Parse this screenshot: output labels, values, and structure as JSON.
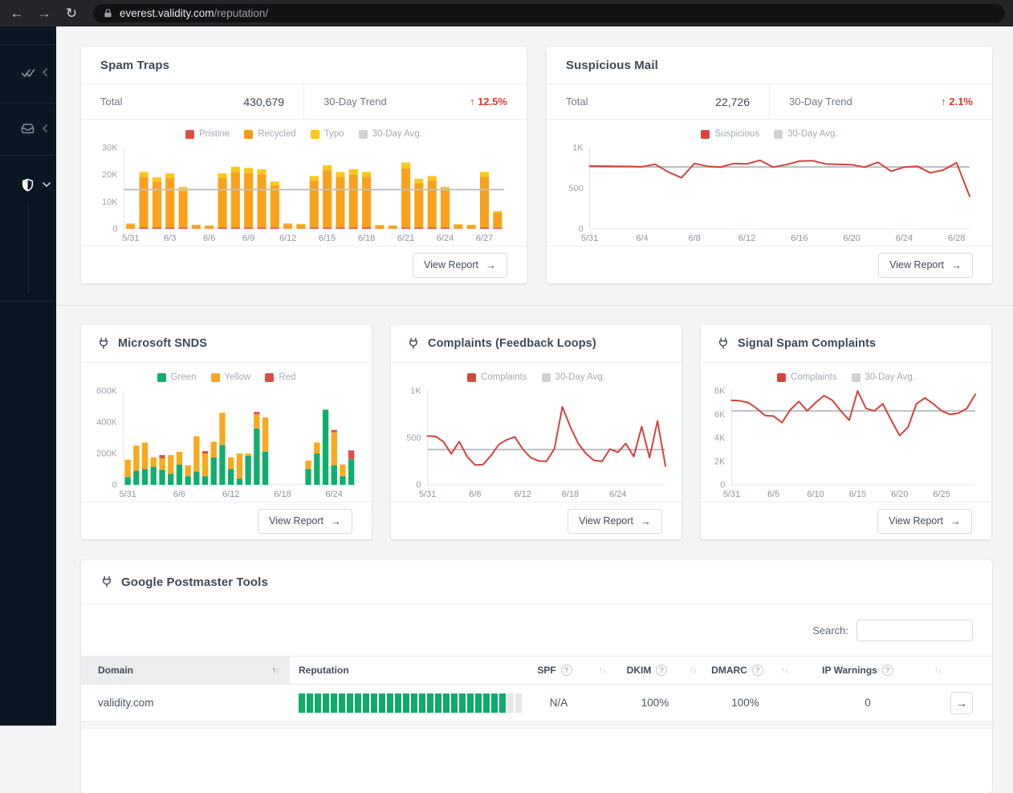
{
  "browser": {
    "back_glyph": "←",
    "forward_glyph": "→",
    "refresh_glyph": "↻",
    "url_host": "everest.validity.com",
    "url_path": "/reputation/"
  },
  "ui": {
    "view_report": "View Report",
    "arrow_right": "→",
    "search_label": "Search:",
    "help_glyph": "?",
    "sort_up": "↑",
    "sort_down": "↓"
  },
  "colors": {
    "trend_red": "#d43a32",
    "chart_red": "#d2423e",
    "avg_gray": "#bdc0c4",
    "orange": "#faa11b",
    "yellow": "#ffc61a",
    "pristine_red": "#d95049",
    "green": "#10ae6d",
    "rep_bar_green": "#10ab6b",
    "sidebar_bg": "#0b1623"
  },
  "sidebar": {
    "items": [
      {
        "name": "validation",
        "icon": "double-check-icon",
        "state": "collapsed"
      },
      {
        "name": "inbox",
        "icon": "inbox-icon",
        "state": "collapsed"
      },
      {
        "name": "reputation",
        "icon": "shield-icon",
        "state": "expanded-active"
      }
    ]
  },
  "cards": {
    "spam_traps": {
      "title": "Spam Traps",
      "total_label": "Total",
      "total_value": "430,679",
      "trend_label": "30-Day Trend",
      "trend_arrow": "↑",
      "trend_value": "12.5%"
    },
    "suspicious_mail": {
      "title": "Suspicious Mail",
      "total_label": "Total",
      "total_value": "22,726",
      "trend_label": "30-Day Trend",
      "trend_arrow": "↑",
      "trend_value": "2.1%"
    },
    "microsoft_snds": {
      "title": "Microsoft SNDS"
    },
    "complaints": {
      "title": "Complaints (Feedback Loops)"
    },
    "signal_spam": {
      "title": "Signal Spam Complaints"
    },
    "google_postmaster": {
      "title": "Google Postmaster Tools",
      "table": {
        "columns": [
          {
            "label": "Domain",
            "sortable": true,
            "sorted": true
          },
          {
            "label": "Reputation",
            "sortable": false
          },
          {
            "label": "SPF",
            "help": true,
            "sortable": true
          },
          {
            "label": "DKIM",
            "help": true,
            "sortable": true
          },
          {
            "label": "DMARC",
            "help": true,
            "sortable": true
          },
          {
            "label": "IP Warnings",
            "help": true,
            "sortable": true
          }
        ],
        "rows": [
          {
            "domain": "validity.com",
            "reputation_segments": 28,
            "reputation_filled": 26,
            "spf": "N/A",
            "dkim": "100%",
            "dmarc": "100%",
            "ip_warnings": "0"
          }
        ]
      }
    }
  },
  "chart_data": [
    {
      "id": "spam_traps",
      "type": "bar",
      "stacked": true,
      "title": "Spam Traps",
      "x_tick_labels": [
        "5/31",
        "6/3",
        "6/6",
        "6/9",
        "6/12",
        "6/15",
        "6/18",
        "6/21",
        "6/24",
        "6/27"
      ],
      "tick_every": 3,
      "ylim": [
        0,
        30000
      ],
      "yticks": [
        [
          0,
          "0"
        ],
        [
          10000,
          "10K"
        ],
        [
          20000,
          "20K"
        ],
        [
          30000,
          "30K"
        ]
      ],
      "avg_line": 14500,
      "legend": [
        {
          "label": "Pristine",
          "color": "#d95049"
        },
        {
          "label": "Recycled",
          "color": "#f8971d"
        },
        {
          "label": "Typo",
          "color": "#ffc61a"
        },
        {
          "label": "30-Day Avg.",
          "color": "#cfd1d4"
        }
      ],
      "series": [
        {
          "name": "Pristine",
          "color": "#d95049",
          "values": [
            100,
            500,
            500,
            500,
            500,
            100,
            100,
            500,
            500,
            500,
            500,
            500,
            100,
            100,
            500,
            500,
            500,
            500,
            500,
            100,
            100,
            500,
            500,
            500,
            500,
            100,
            100,
            500,
            300
          ]
        },
        {
          "name": "Recycled",
          "color": "#faa11b",
          "values": [
            1600,
            18700,
            16900,
            18200,
            13500,
            1200,
            1000,
            18200,
            20500,
            20000,
            19600,
            15500,
            1600,
            1400,
            17300,
            21000,
            18700,
            19600,
            18700,
            1100,
            1000,
            21800,
            16400,
            17300,
            13600,
            1350,
            1200,
            18700,
            5500
          ]
        },
        {
          "name": "Typo",
          "color": "#ffc61a",
          "values": [
            300,
            1800,
            1600,
            1800,
            1500,
            200,
            200,
            1800,
            2000,
            2000,
            1900,
            1500,
            300,
            300,
            1700,
            2000,
            1800,
            1900,
            1800,
            200,
            200,
            2200,
            1600,
            1700,
            1400,
            250,
            200,
            1800,
            700
          ]
        }
      ]
    },
    {
      "id": "suspicious_mail",
      "type": "line",
      "title": "Suspicious Mail",
      "x_tick_labels": [
        "5/31",
        "6/4",
        "6/8",
        "6/12",
        "6/16",
        "6/20",
        "6/24",
        "6/28"
      ],
      "tick_every": 4,
      "ylim": [
        0,
        1000
      ],
      "yticks": [
        [
          0,
          "0"
        ],
        [
          500,
          "500"
        ],
        [
          1000,
          "1K"
        ]
      ],
      "avg_line": 762,
      "legend": [
        {
          "label": "Suspicious",
          "color": "#d8453f"
        },
        {
          "label": "30-Day Avg.",
          "color": "#cfd1d4"
        }
      ],
      "series": [
        {
          "name": "Suspicious",
          "color": "#d2423e",
          "values": [
            775,
            772,
            770,
            768,
            765,
            795,
            700,
            630,
            805,
            770,
            760,
            805,
            800,
            845,
            760,
            790,
            835,
            840,
            800,
            795,
            790,
            760,
            820,
            710,
            760,
            770,
            690,
            725,
            815,
            400
          ]
        }
      ]
    },
    {
      "id": "microsoft_snds",
      "type": "bar",
      "stacked": true,
      "title": "Microsoft SNDS",
      "x_tick_labels": [
        "5/31",
        "6/6",
        "6/12",
        "6/18",
        "6/24"
      ],
      "tick_every": 6,
      "ylim": [
        0,
        600000
      ],
      "yticks": [
        [
          0,
          "0"
        ],
        [
          200000,
          "200K"
        ],
        [
          400000,
          "400K"
        ],
        [
          600000,
          "600K"
        ]
      ],
      "avg_line": null,
      "legend": [
        {
          "label": "Green",
          "color": "#10ae6d"
        },
        {
          "label": "Yellow",
          "color": "#f8a91d"
        },
        {
          "label": "Red",
          "color": "#dd4f44"
        }
      ],
      "series": [
        {
          "name": "Green",
          "color": "#10ae6d",
          "values": [
            50000,
            90000,
            100000,
            115000,
            95000,
            70000,
            130000,
            55000,
            85000,
            55000,
            175000,
            255000,
            100000,
            40000,
            185000,
            360000,
            210000,
            0,
            0,
            0,
            0,
            100000,
            200000,
            480000,
            125000,
            55000,
            160000
          ]
        },
        {
          "name": "Yellow",
          "color": "#f9a91b",
          "values": [
            110000,
            160000,
            170000,
            60000,
            75000,
            120000,
            80000,
            70000,
            225000,
            145000,
            100000,
            205000,
            75000,
            160000,
            15000,
            90000,
            220000,
            0,
            0,
            0,
            0,
            55000,
            70000,
            0,
            210000,
            75000,
            0
          ]
        },
        {
          "name": "Red",
          "color": "#d9524a",
          "values": [
            0,
            0,
            0,
            0,
            20000,
            0,
            0,
            0,
            0,
            15000,
            0,
            0,
            0,
            0,
            0,
            15000,
            0,
            0,
            0,
            0,
            0,
            0,
            0,
            0,
            15000,
            0,
            60000
          ]
        }
      ]
    },
    {
      "id": "complaints",
      "type": "line",
      "title": "Complaints (Feedback Loops)",
      "x_tick_labels": [
        "5/31",
        "6/6",
        "6/12",
        "6/18",
        "6/24"
      ],
      "tick_every": 6,
      "ylim": [
        0,
        1000
      ],
      "yticks": [
        [
          0,
          "0"
        ],
        [
          500,
          "500"
        ],
        [
          1000,
          "1K"
        ]
      ],
      "avg_line": 375,
      "legend": [
        {
          "label": "Complaints",
          "color": "#d8453f"
        },
        {
          "label": "30-Day Avg.",
          "color": "#cfd1d4"
        }
      ],
      "series": [
        {
          "name": "Complaints",
          "color": "#d2423e",
          "values": [
            520,
            515,
            460,
            330,
            460,
            300,
            210,
            215,
            310,
            430,
            480,
            510,
            380,
            290,
            255,
            250,
            385,
            830,
            620,
            440,
            330,
            260,
            250,
            380,
            345,
            440,
            300,
            620,
            290,
            680,
            200
          ]
        }
      ]
    },
    {
      "id": "signal_spam",
      "type": "line",
      "title": "Signal Spam Complaints",
      "x_tick_labels": [
        "5/31",
        "6/5",
        "6/10",
        "6/15",
        "6/20",
        "6/25"
      ],
      "tick_every": 5,
      "ylim": [
        0,
        8000
      ],
      "yticks": [
        [
          0,
          "0"
        ],
        [
          2000,
          "2K"
        ],
        [
          4000,
          "4K"
        ],
        [
          6000,
          "6K"
        ],
        [
          8000,
          "8K"
        ]
      ],
      "avg_line": 6300,
      "legend": [
        {
          "label": "Complaints",
          "color": "#d8453f"
        },
        {
          "label": "30-Day Avg.",
          "color": "#cfd1d4"
        }
      ],
      "series": [
        {
          "name": "Complaints",
          "color": "#d2423e",
          "values": [
            7200,
            7150,
            7000,
            6500,
            5900,
            5850,
            5300,
            6400,
            7100,
            6300,
            7000,
            7600,
            7200,
            6300,
            5500,
            8000,
            6500,
            6300,
            6900,
            5500,
            4200,
            4900,
            6900,
            7400,
            6900,
            6300,
            6000,
            6100,
            6500,
            7700
          ]
        }
      ]
    }
  ]
}
